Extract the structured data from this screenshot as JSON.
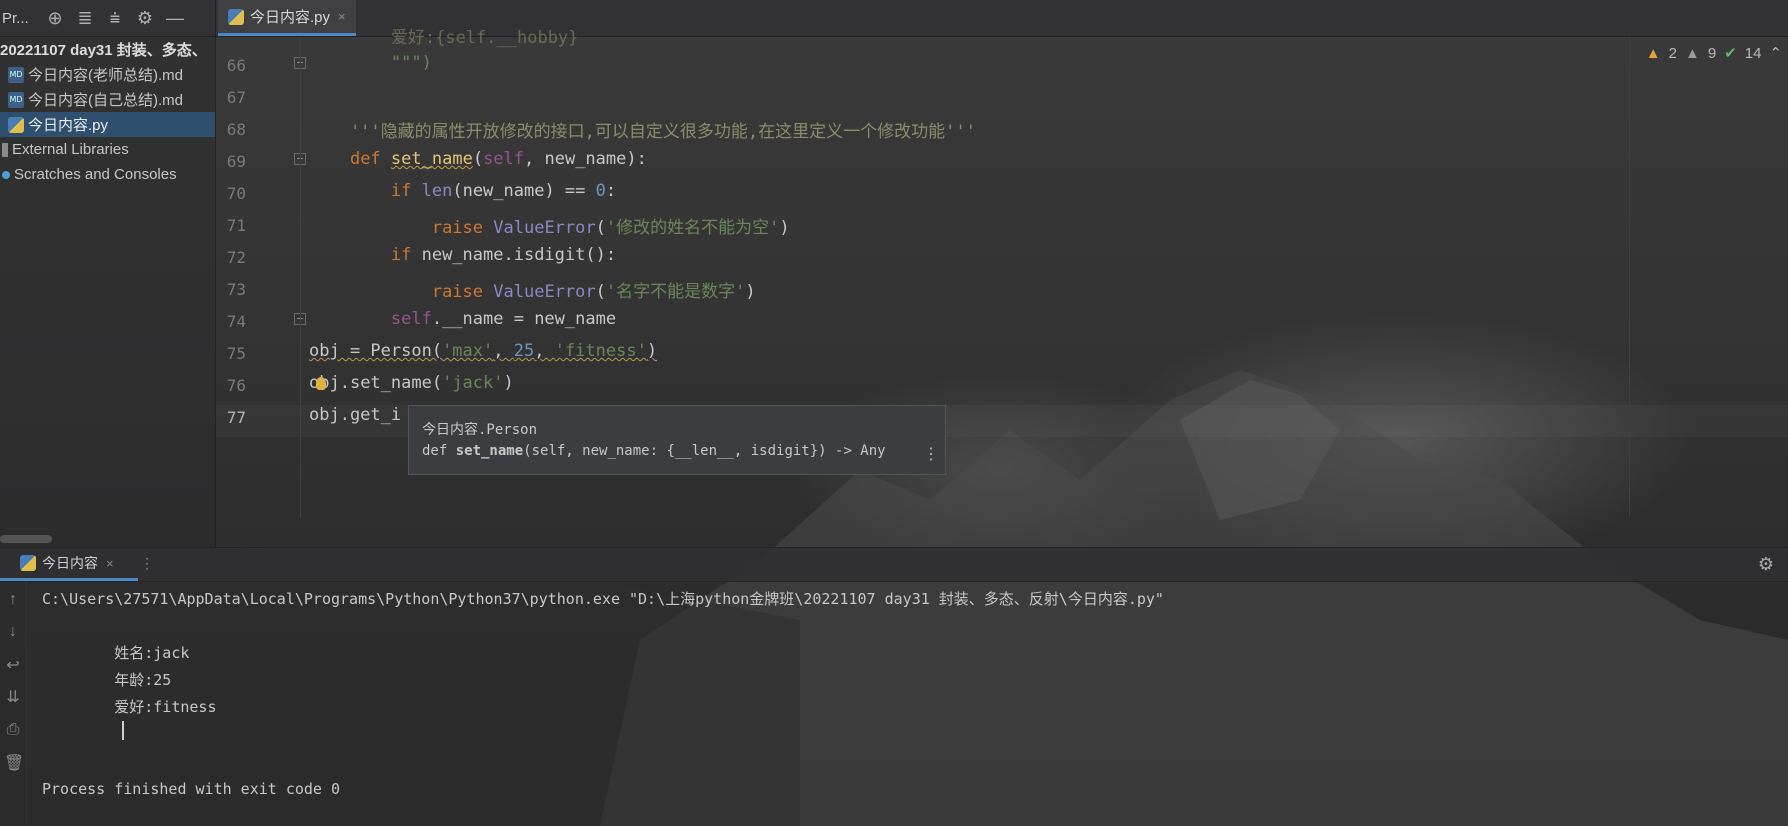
{
  "window": {
    "project_short": "Pr...",
    "tab_label": "今日内容.py",
    "tab_close": "×"
  },
  "toolbar_icons": [
    "locate-icon",
    "expand-all-icon",
    "collapse-all-icon",
    "gear-icon",
    "minimize-icon"
  ],
  "tree": {
    "items": [
      {
        "label": "20221107 day31 封装、多态、",
        "icon": "folder-icon"
      },
      {
        "label": "今日内容(老师总结).md",
        "icon": "markdown-file-icon"
      },
      {
        "label": "今日内容(自己总结).md",
        "icon": "markdown-file-icon"
      },
      {
        "label": "今日内容.py",
        "icon": "python-file-icon",
        "selected": true
      },
      {
        "label": "External Libraries",
        "icon": "library-icon"
      },
      {
        "label": "Scratches and Consoles",
        "icon": "scratches-icon"
      }
    ]
  },
  "inspections": {
    "warnings": "2",
    "weak_warnings": "9",
    "ok": "14"
  },
  "editor": {
    "line_numbers": [
      "66",
      "67",
      "68",
      "69",
      "70",
      "71",
      "72",
      "73",
      "74",
      "75",
      "76",
      "77"
    ],
    "current_line": "77",
    "partial_top_line": "        爱好:{self.__hobby}",
    "lines": {
      "l66": "        \"\"\")",
      "l68": "    '''隐藏的属性开放修改的接口,可以自定义很多功能,在这里定义一个修改功能'''",
      "l69_def": "def",
      "l69_fn": "set_name",
      "l69_self": "self",
      "l69_rest": ", new_name):",
      "l70_if": "if",
      "l70_len": "len",
      "l70_mid": "(new_name) == ",
      "l70_num": "0",
      "l70_end": ":",
      "l71_raise": "raise",
      "l71_err": "ValueError",
      "l71_str": "'修改的姓名不能为空'",
      "l72_if": "if",
      "l72_rest": " new_name.isdigit():",
      "l73_raise": "raise",
      "l73_err": "ValueError",
      "l73_str": "'名字不能是数字'",
      "l74_self": "self",
      "l74_rest": ".__name = new_name",
      "l75_a": "obj = Person(",
      "l75_s1": "'max'",
      "l75_c1": ", ",
      "l75_n": "25",
      "l75_c2": ", ",
      "l75_s2": "'fitness'",
      "l75_e": ")",
      "l76_a": "ob",
      "l76_b": "j.set_name(",
      "l76_s": "'jack'",
      "l76_e": ")",
      "l77": "obj.get_i"
    }
  },
  "tooltip": {
    "line1": "今日内容.Person",
    "def": "def ",
    "name": "set_name",
    "sig": "(self, new_name: {__len__, isdigit}) -> Any",
    "more": "⋮"
  },
  "run": {
    "tab_label": "今日内容",
    "tab_close": "×",
    "more": "⋮",
    "console_lines": [
      "C:\\Users\\27571\\AppData\\Local\\Programs\\Python\\Python37\\python.exe \"D:\\上海python金牌班\\20221107 day31 封装、多态、反射\\今日内容.py\"",
      "",
      "        姓名:jack",
      "        年龄:25",
      "        爱好:fitness",
      "",
      "",
      "Process finished with exit code 0"
    ]
  },
  "colors": {
    "accent": "#4a88c7",
    "keyword": "#cc7832",
    "string": "#6a8759",
    "number": "#6897bb",
    "function": "#e6c47a",
    "self": "#94558d"
  }
}
